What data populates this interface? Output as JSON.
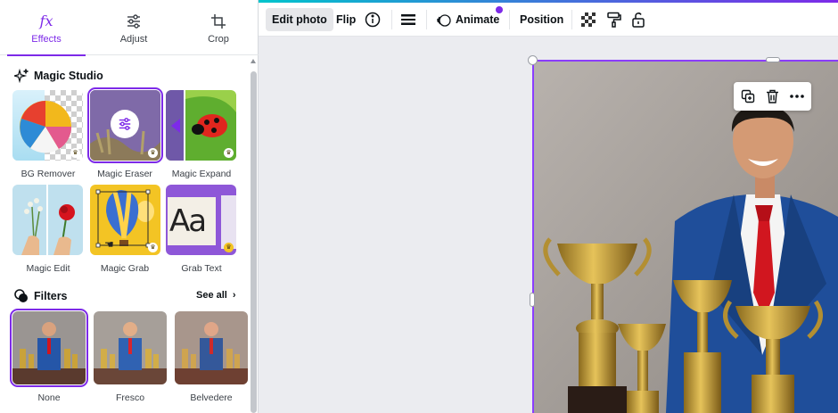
{
  "tabs": [
    {
      "label": "Effects",
      "icon": "fx-icon",
      "active": true
    },
    {
      "label": "Adjust",
      "icon": "sliders-icon",
      "active": false
    },
    {
      "label": "Crop",
      "icon": "crop-icon",
      "active": false
    }
  ],
  "magic_studio": {
    "title": "Magic Studio",
    "items": [
      {
        "label": "BG Remover",
        "premium": true
      },
      {
        "label": "Magic Eraser",
        "premium": true,
        "selected": true
      },
      {
        "label": "Magic Expand",
        "premium": true
      },
      {
        "label": "Magic Edit",
        "premium": false
      },
      {
        "label": "Magic Grab",
        "premium": true
      },
      {
        "label": "Grab Text",
        "premium": true
      }
    ]
  },
  "filters": {
    "title": "Filters",
    "see_all": "See all",
    "items": [
      {
        "label": "None",
        "selected": true
      },
      {
        "label": "Fresco",
        "selected": false
      },
      {
        "label": "Belvedere",
        "selected": false
      }
    ]
  },
  "toolbar": {
    "edit_photo": "Edit photo",
    "flip": "Flip",
    "animate": "Animate",
    "position": "Position"
  },
  "colors": {
    "accent": "#7d2ae8",
    "selection": "#8b3dff",
    "jacket": "#1f4e9a",
    "tie": "#d1161f",
    "gold": "#c9a23a"
  }
}
